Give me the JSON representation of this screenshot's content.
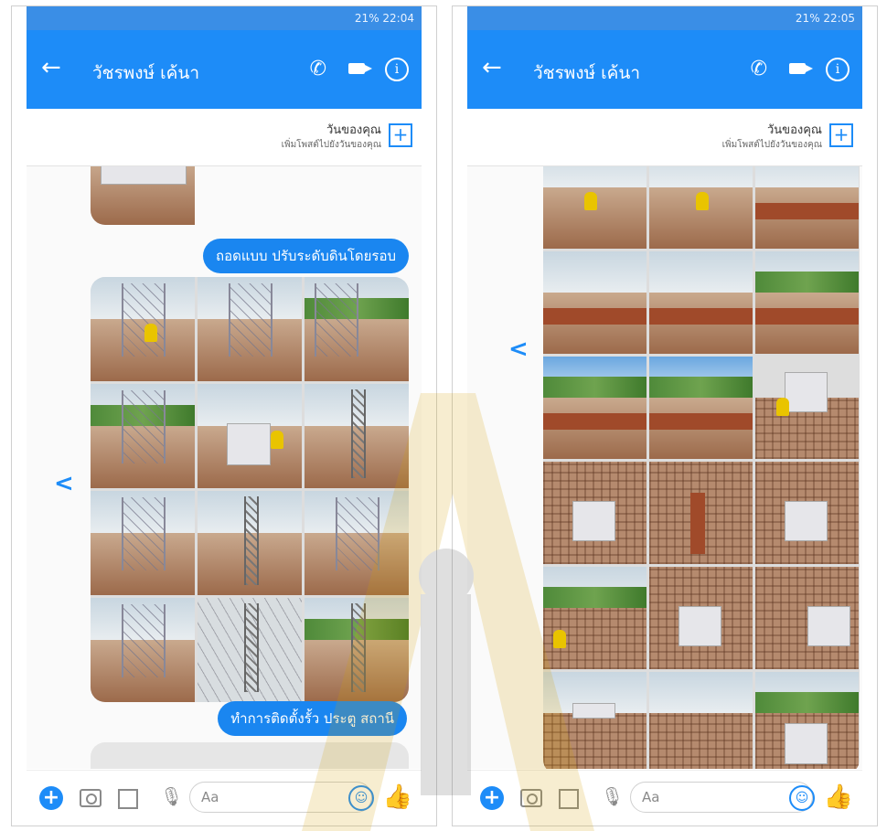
{
  "screens": [
    {
      "status_text": "21% 22:04",
      "contact_name": "วัชรพงษ์ เค้นา",
      "day": {
        "title": "วันของคุณ",
        "subtitle": "เพิ่มโพสต์ไปยังวันของคุณ"
      },
      "messages": [
        "ถอดแบบ ปรับระดับดินโดยรอบ",
        "ทำการติดตั้งรั้ว ประตู สถานี"
      ],
      "composer_placeholder": "Aa"
    },
    {
      "status_text": "21% 22:05",
      "contact_name": "วัชรพงษ์ เค้นา",
      "day": {
        "title": "วันของคุณ",
        "subtitle": "เพิ่มโพสต์ไปยังวันของคุณ"
      },
      "messages": [],
      "composer_placeholder": "Aa"
    }
  ],
  "icons": {
    "back": "arrow-left-icon",
    "call": "phone-icon",
    "video": "video-camera-icon",
    "info": "info-icon",
    "add_day": "plus-square-icon",
    "share": "share-icon",
    "add": "plus-circle-icon",
    "camera": "camera-icon",
    "gallery": "image-icon",
    "mic": "microphone-icon",
    "emoji": "emoji-icon",
    "like": "thumbs-up-icon"
  },
  "colors": {
    "accent": "#1d8cf8",
    "bubble": "#1a86f0"
  }
}
